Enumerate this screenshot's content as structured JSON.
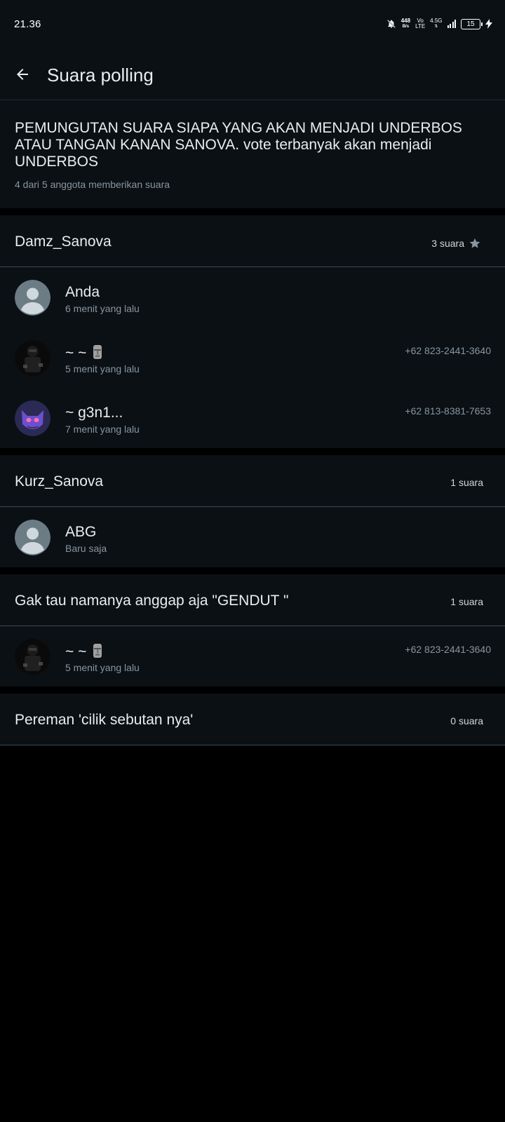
{
  "status_bar": {
    "time": "21.36",
    "speed_value": "448",
    "speed_unit": "B/s",
    "volte_top": "Vo",
    "volte_bottom": "LTE",
    "network": "4.5G",
    "battery": "15"
  },
  "header": {
    "title": "Suara polling",
    "back_icon": "arrow-left-icon"
  },
  "poll": {
    "question": "PEMUNGUTAN SUARA SIAPA YANG AKAN MENJADI UNDERBOS ATAU TANGAN KANAN SANOVA. vote terbanyak akan menjadi UNDERBOS",
    "meta": "4 dari 5 anggota memberikan suara"
  },
  "options": [
    {
      "title": "Damz_Sanova",
      "count": "3 suara",
      "winner_icon": "star-icon",
      "voters": [
        {
          "name": "Anda",
          "time": "6 menit yang lalu",
          "phone": ""
        },
        {
          "name": "~ ~",
          "time": "5 menit yang lalu",
          "phone": "+62 823-2441-3640"
        },
        {
          "name": "~ g3n1...",
          "time": "7 menit yang lalu",
          "phone": "+62 813-8381-7653"
        }
      ]
    },
    {
      "title": "Kurz_Sanova",
      "count": "1 suara",
      "voters": [
        {
          "name": "ABG",
          "time": "Baru saja",
          "phone": ""
        }
      ]
    },
    {
      "title": "Gak tau namanya anggap aja \"GENDUT \"",
      "count": "1 suara",
      "voters": [
        {
          "name": "~ ~",
          "time": "5 menit yang lalu",
          "phone": "+62 823-2441-3640"
        }
      ]
    },
    {
      "title": "Pereman 'cilik sebutan nya'",
      "count": "0 suara",
      "voters": []
    }
  ],
  "colors": {
    "background": "#0b1014",
    "text_primary": "#e9edef",
    "text_secondary": "#8696a0",
    "divider": "#3b4a54"
  }
}
